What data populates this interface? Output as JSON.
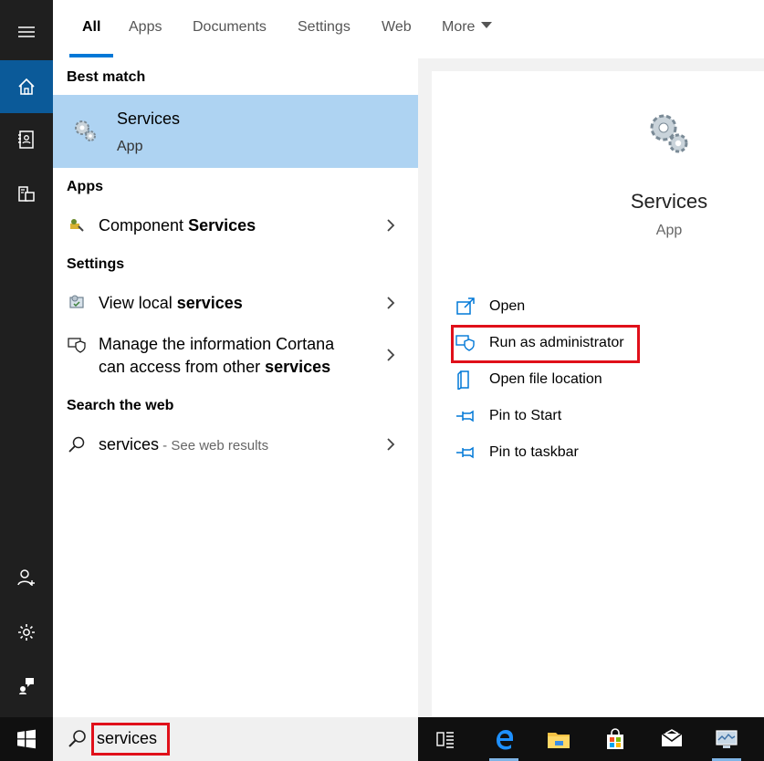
{
  "tabs": [
    {
      "label": "All"
    },
    {
      "label": "Apps"
    },
    {
      "label": "Documents"
    },
    {
      "label": "Settings"
    },
    {
      "label": "Web"
    },
    {
      "label": "More"
    }
  ],
  "results": {
    "best_match_header": "Best match",
    "best_match": {
      "title": "Services",
      "subtitle": "App"
    },
    "apps_header": "Apps",
    "apps": [
      {
        "text_plain": "Component ",
        "text_bold": "Services"
      }
    ],
    "settings_header": "Settings",
    "settings": [
      {
        "text_plain": "View local ",
        "text_bold": "services"
      },
      {
        "line1": "Manage the information Cortana",
        "line2_plain": "can access from other ",
        "line2_bold": "services"
      }
    ],
    "web_header": "Search the web",
    "web": [
      {
        "query": "services",
        "suffix": " - See web results"
      }
    ]
  },
  "details": {
    "title": "Services",
    "subtitle": "App",
    "actions": [
      {
        "label": "Open",
        "icon": "open-icon"
      },
      {
        "label": "Run as administrator",
        "icon": "shield-icon"
      },
      {
        "label": "Open file location",
        "icon": "file-location-icon"
      },
      {
        "label": "Pin to Start",
        "icon": "pin-icon"
      },
      {
        "label": "Pin to taskbar",
        "icon": "pin-icon"
      }
    ]
  },
  "search": {
    "value": "services"
  },
  "colors": {
    "accent": "#0078d7",
    "highlight": "#aed3f2",
    "annotation": "#e0101a"
  }
}
